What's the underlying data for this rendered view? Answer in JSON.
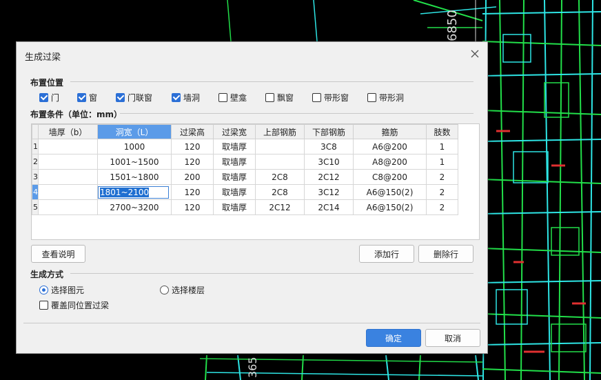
{
  "background": {
    "cad_label_top": "6850",
    "cad_label_bottom": "365"
  },
  "dialog": {
    "title": "生成过梁",
    "close": "×",
    "placement": {
      "title": "布置位置",
      "options": [
        {
          "label": "门",
          "checked": true
        },
        {
          "label": "窗",
          "checked": true
        },
        {
          "label": "门联窗",
          "checked": true
        },
        {
          "label": "墙洞",
          "checked": true
        },
        {
          "label": "壁龛",
          "checked": false
        },
        {
          "label": "飘窗",
          "checked": false
        },
        {
          "label": "带形窗",
          "checked": false
        },
        {
          "label": "带形洞",
          "checked": false
        }
      ]
    },
    "conditions": {
      "title": "布置条件（单位：mm）",
      "headers": [
        "墙厚（b）",
        "洞宽（L）",
        "过梁高",
        "过梁宽",
        "上部钢筋",
        "下部钢筋",
        "箍筋",
        "肢数"
      ],
      "rows": [
        {
          "num": "1",
          "cells": [
            "",
            "1000",
            "120",
            "取墙厚",
            "",
            "3C8",
            "A6@200",
            "1"
          ]
        },
        {
          "num": "2",
          "cells": [
            "",
            "1001~1500",
            "120",
            "取墙厚",
            "",
            "3C10",
            "A8@200",
            "1"
          ]
        },
        {
          "num": "3",
          "cells": [
            "",
            "1501~1800",
            "200",
            "取墙厚",
            "2C8",
            "2C12",
            "C8@200",
            "2"
          ]
        },
        {
          "num": "4",
          "cells": [
            "",
            "1801~2100",
            "120",
            "取墙厚",
            "2C8",
            "3C12",
            "A6@150(2)",
            "2"
          ]
        },
        {
          "num": "5",
          "cells": [
            "",
            "2700~3200",
            "120",
            "取墙厚",
            "2C12",
            "2C14",
            "A6@150(2)",
            "2"
          ]
        }
      ]
    },
    "buttons": {
      "help": "查看说明",
      "add_row": "添加行",
      "delete_row": "删除行",
      "ok": "确定",
      "cancel": "取消"
    },
    "mode": {
      "title": "生成方式",
      "select_element": "选择图元",
      "select_floor": "选择楼层",
      "selected": "select_element",
      "overwrite": "覆盖同位置过梁",
      "overwrite_checked": false
    }
  },
  "colors": {
    "accent": "#3a82e0",
    "header_highlight": "#5b9be8",
    "cad_green": "#22e04a",
    "cad_cyan": "#2ee6e6",
    "cad_red": "#e03030"
  }
}
